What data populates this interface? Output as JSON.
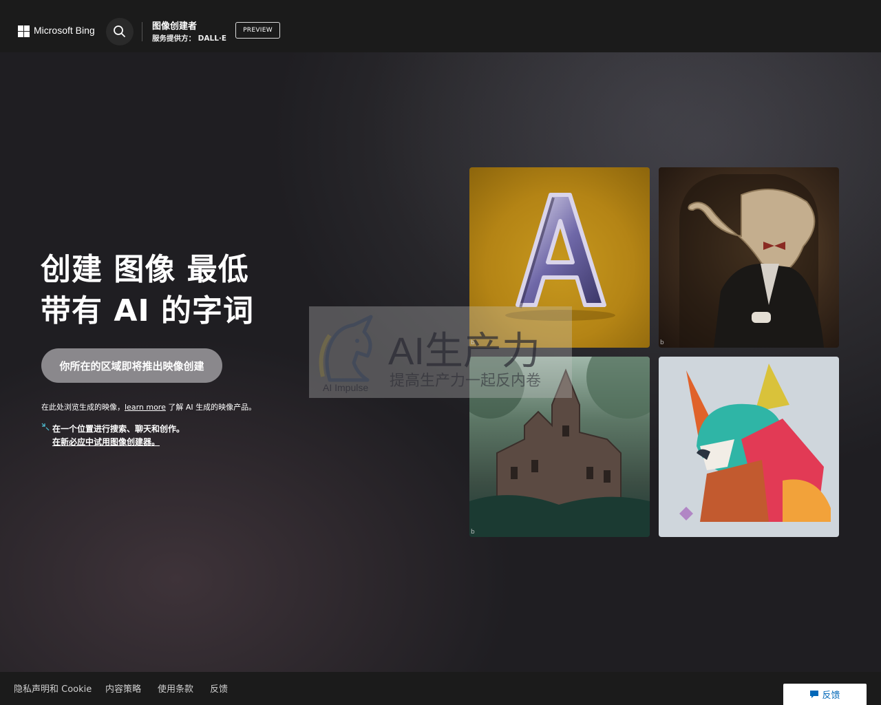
{
  "header": {
    "brand": "Microsoft Bing",
    "product_title": "图像创建者",
    "product_subtitle": "服务提供方： DALL·E",
    "preview_badge": "PREVIEW"
  },
  "hero": {
    "title_line1": "创建 图像 最低",
    "title_line2": "带有 AI 的字词",
    "cta_label": "你所在的区域即将推出映像创建",
    "browse_prefix": "在此处浏览生成的映像，",
    "learn_more": "learn more",
    "browse_suffix": " 了解 AI 生成的映像产品。",
    "promo_line1": "在一个位置进行搜索、聊天和创作。",
    "promo_line2": "在新必应中试用图像创建器。"
  },
  "watermark": {
    "title": "AI生产力",
    "subtitle": "提高生产力一起反内卷",
    "brand": "AI Impulse"
  },
  "footer": {
    "links": [
      "隐私声明和 Cookie",
      "内容策略",
      "使用条款",
      "反馈"
    ],
    "feedback_button": "反馈"
  },
  "colors": {
    "header_bg": "#1b1b1b",
    "cta_bg": "#8a888c",
    "feedback_text": "#0067b8"
  }
}
